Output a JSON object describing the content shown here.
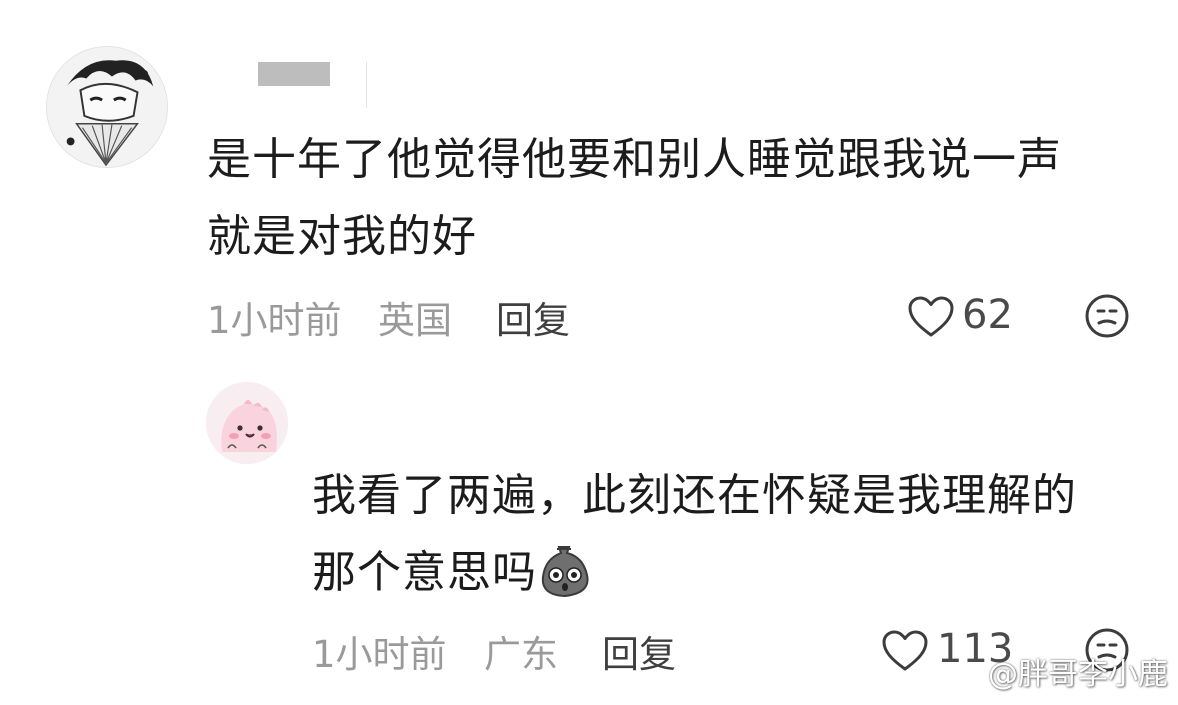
{
  "comments": [
    {
      "username": "",
      "text_lines": [
        "是十年了他觉得他要和别人睡觉跟我说一声",
        "就是对我的好"
      ],
      "time": "1小时前",
      "location": "英国",
      "reply_label": "回复",
      "likes": "62",
      "avatar_icon": "manga-character-avatar",
      "like_icon": "heart-outline-icon",
      "dislike_icon": "meh-face-icon"
    },
    {
      "text_lines": [
        "我看了两遍，此刻还在怀疑是我理解的",
        "那个意思吗"
      ],
      "emoji": "shocked-rock-sticker",
      "time": "1小时前",
      "location": "广东",
      "reply_label": "回复",
      "likes": "113",
      "avatar_icon": "pink-dinosaur-avatar",
      "like_icon": "heart-outline-icon",
      "dislike_icon": "meh-face-icon"
    }
  ],
  "watermark": {
    "text": "@胖哥李小鹿",
    "logo_icon": "weibo-logo-icon"
  },
  "colors": {
    "meta_text": "#9a9a9a",
    "body_text": "#1c1c1c",
    "reply_text": "#3f3f3f",
    "icon_stroke": "#3c3c3c"
  }
}
